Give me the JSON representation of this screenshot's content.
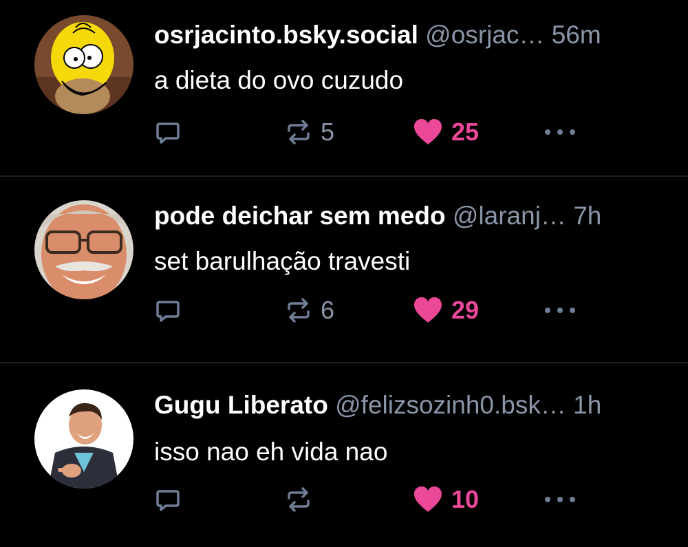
{
  "colors": {
    "background": "#000000",
    "divider": "#1c1f26",
    "muted": "#8a96a8",
    "like": "#ec4899",
    "icon": "#6f7e96"
  },
  "posts": [
    {
      "display_name": "osrjacinto.bsky.social",
      "handle": "@osrjac…",
      "time": "56m",
      "text": "a dieta do ovo cuzudo",
      "avatar": "homer-simpson-avatar",
      "reposts": "5",
      "likes": "25",
      "liked": true
    },
    {
      "display_name": "pode deichar sem medo",
      "handle": "@laranj…",
      "time": "7h",
      "text": "set barulhação travesti",
      "avatar": "smiling-man-glasses-avatar",
      "reposts": "6",
      "likes": "29",
      "liked": true
    },
    {
      "display_name": "Gugu Liberato",
      "handle": "@felizsozinh0.bsk…",
      "time": "1h",
      "text": "isso nao eh vida nao",
      "avatar": "man-pointing-avatar",
      "reposts": "",
      "likes": "10",
      "liked": true
    }
  ],
  "icons": {
    "reply": "reply-icon",
    "repost": "repost-icon",
    "like": "heart-icon",
    "more": "more-options-icon"
  }
}
